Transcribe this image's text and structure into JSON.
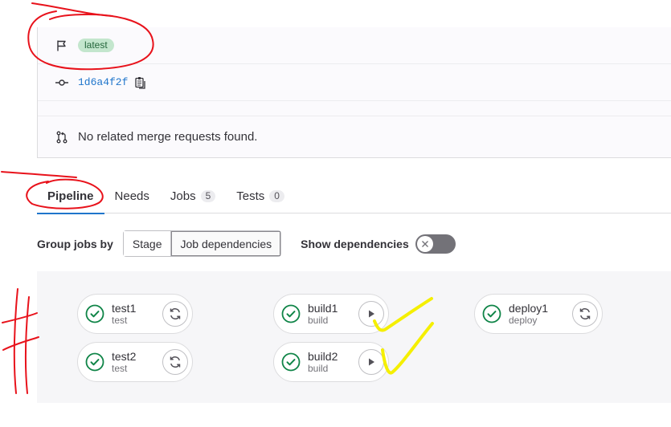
{
  "info": {
    "flag_icon": "flag-icon",
    "tag_badge": "latest",
    "commit_icon": "commit-icon",
    "commit_sha": "1d6a4f2f",
    "copy_icon": "copy-icon",
    "mr_icon": "merge-request-icon",
    "merge_requests_text": "No related merge requests found."
  },
  "tabs": [
    {
      "label": "Pipeline",
      "active": true
    },
    {
      "label": "Needs"
    },
    {
      "label": "Jobs",
      "count": "5"
    },
    {
      "label": "Tests",
      "count": "0"
    }
  ],
  "group_by": {
    "label": "Group jobs by",
    "options": [
      "Stage",
      "Job dependencies"
    ],
    "selected": "Job dependencies",
    "show_dependencies_label": "Show dependencies",
    "show_dependencies_on": false
  },
  "jobs": [
    {
      "name": "test1",
      "stage": "test",
      "status": "success",
      "action": "retry"
    },
    {
      "name": "test2",
      "stage": "test",
      "status": "success",
      "action": "retry"
    },
    {
      "name": "build1",
      "stage": "build",
      "status": "success",
      "action": "play"
    },
    {
      "name": "build2",
      "stage": "build",
      "status": "success",
      "action": "play"
    },
    {
      "name": "deploy1",
      "stage": "deploy",
      "status": "success",
      "action": "retry"
    }
  ],
  "colors": {
    "success": "#108548",
    "link": "#1f75cb",
    "annotation_red": "#e8121b",
    "annotation_yellow": "#f5ef00"
  }
}
